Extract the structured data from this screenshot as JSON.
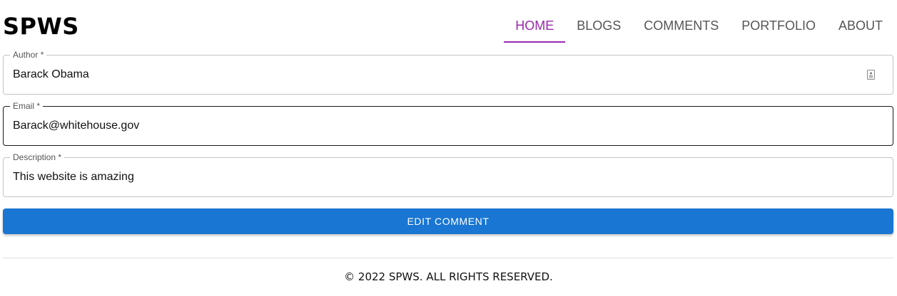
{
  "brand": "SPWS",
  "nav": {
    "items": [
      {
        "label": "HOME",
        "active": true
      },
      {
        "label": "BLOGS"
      },
      {
        "label": "COMMENTS"
      },
      {
        "label": "PORTFOLIO"
      },
      {
        "label": "ABOUT"
      }
    ]
  },
  "form": {
    "author": {
      "label": "Author *",
      "value": "Barack Obama",
      "icon": "contact-card-icon"
    },
    "email": {
      "label": "Email *",
      "value": "Barack@whitehouse.gov",
      "focused": true
    },
    "description": {
      "label": "Description *",
      "value": "This website is amazing"
    },
    "submit_label": "EDIT COMMENT"
  },
  "footer": {
    "text": "© 2022 SPWS. ALL RIGHTS RESERVED."
  },
  "colors": {
    "accent": "#9c27b0",
    "primary_button": "#1976d2"
  }
}
